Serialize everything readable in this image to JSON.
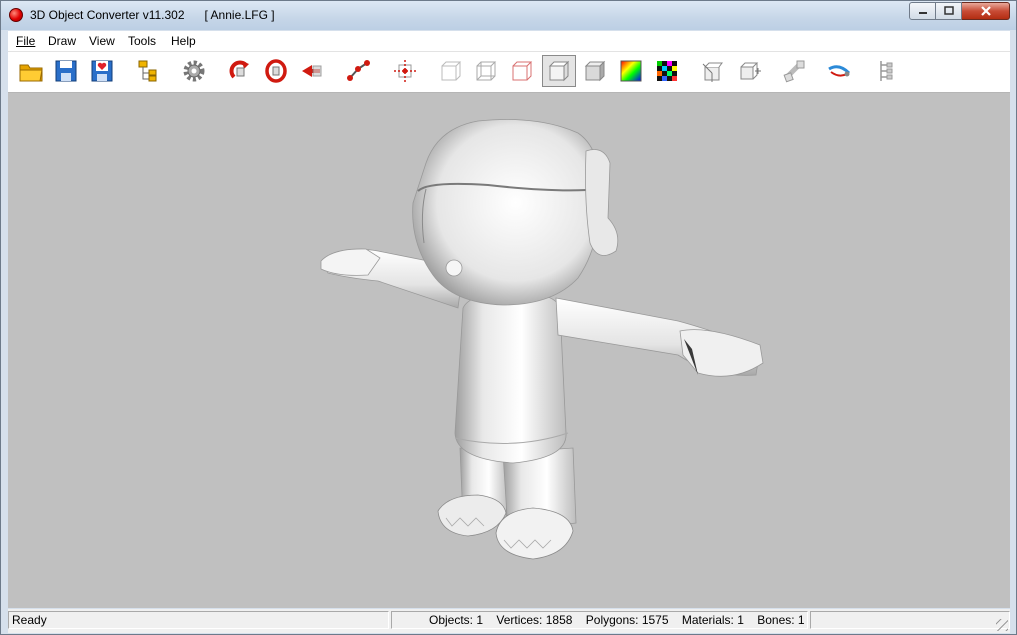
{
  "window": {
    "app_title": "3D Object Converter v11.302",
    "file_title": "[ Annie.LFG ]",
    "minimize_label": "▁",
    "maximize_label": "□",
    "close_label": "✕"
  },
  "menu": [
    {
      "label": "File"
    },
    {
      "label": "Draw"
    },
    {
      "label": "View"
    },
    {
      "label": "Tools"
    },
    {
      "label": "Help"
    }
  ],
  "toolbar": {
    "icons": [
      "open-folder-icon",
      "save-icon",
      "save-favorite-icon",
      "object-tree-icon",
      "settings-gear-icon",
      "rotate-x-icon",
      "rotate-y-icon",
      "flip-icon",
      "vertex-edit-icon",
      "pivot-icon",
      "wireframe-icon",
      "wireframe-gray-icon",
      "wireframe-red-icon",
      "solid-cube-icon",
      "shaded-cube-icon",
      "rainbow-texture-icon",
      "checker-texture-icon",
      "normals-icon",
      "bounding-box-icon",
      "bones-icon",
      "camera-icon",
      "hierarchy-icon"
    ],
    "pressed": "solid-cube-icon"
  },
  "status": {
    "text": "Ready",
    "objects": "Objects: 1",
    "vertices": "Vertices: 1858",
    "polygons": "Polygons: 1575",
    "materials": "Materials: 1",
    "bones": "Bones: 1"
  },
  "colors": {
    "viewport_bg": "#c0c0c0",
    "model_fill": "#f2f2f2"
  }
}
